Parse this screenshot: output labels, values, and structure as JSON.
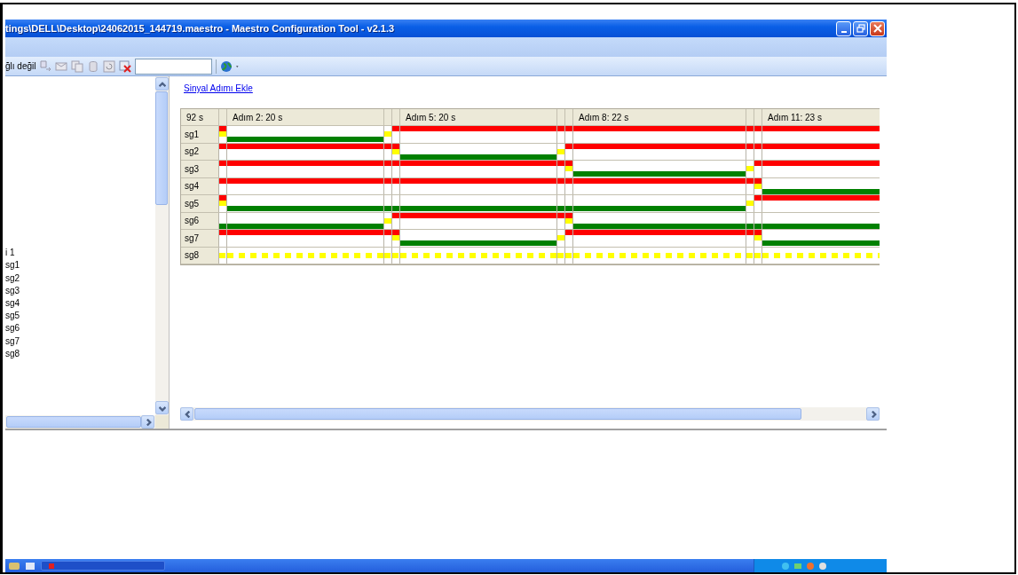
{
  "window": {
    "title": "tings\\DELL\\Desktop\\24062015_144719.maestro - Maestro Configuration Tool - v2.1.3"
  },
  "toolbar": {
    "status": "ğlı değil"
  },
  "tree": [
    {
      "label": "i 1",
      "children": [
        {
          "label": "sg1"
        },
        {
          "label": "sg2"
        },
        {
          "label": "sg3"
        },
        {
          "label": "sg4"
        },
        {
          "label": "sg5"
        },
        {
          "label": "sg6"
        },
        {
          "label": "sg7"
        },
        {
          "label": "sg8"
        }
      ]
    }
  ],
  "editor": {
    "add_link": "Sinyal Adımı Ekle",
    "total": "92 s",
    "columns": [
      {
        "kind": "transition"
      },
      {
        "kind": "step",
        "label": "Adım 2: 20 s"
      },
      {
        "kind": "transition"
      },
      {
        "kind": "transition"
      },
      {
        "kind": "step",
        "label": "Adım 5: 20 s"
      },
      {
        "kind": "transition"
      },
      {
        "kind": "transition"
      },
      {
        "kind": "step",
        "label": "Adım 8: 22 s"
      },
      {
        "kind": "transition"
      },
      {
        "kind": "transition"
      },
      {
        "kind": "step",
        "label": "Adım 11: 23 s"
      }
    ],
    "signals": [
      {
        "name": "sg1",
        "segments": [
          {
            "kind": "redamber"
          },
          {
            "kind": "green"
          },
          {
            "kind": "amber"
          },
          {
            "kind": "red"
          },
          {
            "kind": "red"
          },
          {
            "kind": "red"
          },
          {
            "kind": "red"
          },
          {
            "kind": "red"
          },
          {
            "kind": "red"
          },
          {
            "kind": "red"
          },
          {
            "kind": "red"
          }
        ]
      },
      {
        "name": "sg2",
        "segments": [
          {
            "kind": "red"
          },
          {
            "kind": "red"
          },
          {
            "kind": "red"
          },
          {
            "kind": "redamber"
          },
          {
            "kind": "green"
          },
          {
            "kind": "amber"
          },
          {
            "kind": "red"
          },
          {
            "kind": "red"
          },
          {
            "kind": "red"
          },
          {
            "kind": "red"
          },
          {
            "kind": "red"
          }
        ]
      },
      {
        "name": "sg3",
        "segments": [
          {
            "kind": "red"
          },
          {
            "kind": "red"
          },
          {
            "kind": "red"
          },
          {
            "kind": "red"
          },
          {
            "kind": "red"
          },
          {
            "kind": "red"
          },
          {
            "kind": "redamber"
          },
          {
            "kind": "green"
          },
          {
            "kind": "amber"
          },
          {
            "kind": "red"
          },
          {
            "kind": "red"
          }
        ]
      },
      {
        "name": "sg4",
        "segments": [
          {
            "kind": "red"
          },
          {
            "kind": "red"
          },
          {
            "kind": "red"
          },
          {
            "kind": "red"
          },
          {
            "kind": "red"
          },
          {
            "kind": "red"
          },
          {
            "kind": "red"
          },
          {
            "kind": "red"
          },
          {
            "kind": "red"
          },
          {
            "kind": "redamber"
          },
          {
            "kind": "green"
          }
        ]
      },
      {
        "name": "sg5",
        "segments": [
          {
            "kind": "redamber"
          },
          {
            "kind": "green"
          },
          {
            "kind": "green"
          },
          {
            "kind": "green"
          },
          {
            "kind": "green"
          },
          {
            "kind": "green"
          },
          {
            "kind": "green"
          },
          {
            "kind": "green"
          },
          {
            "kind": "amber"
          },
          {
            "kind": "red"
          },
          {
            "kind": "red"
          }
        ]
      },
      {
        "name": "sg6",
        "segments": [
          {
            "kind": "green"
          },
          {
            "kind": "green"
          },
          {
            "kind": "amber"
          },
          {
            "kind": "red"
          },
          {
            "kind": "red"
          },
          {
            "kind": "red"
          },
          {
            "kind": "redamber"
          },
          {
            "kind": "green"
          },
          {
            "kind": "green"
          },
          {
            "kind": "green"
          },
          {
            "kind": "green"
          }
        ]
      },
      {
        "name": "sg7",
        "segments": [
          {
            "kind": "red"
          },
          {
            "kind": "red"
          },
          {
            "kind": "red"
          },
          {
            "kind": "redamber"
          },
          {
            "kind": "green"
          },
          {
            "kind": "amber"
          },
          {
            "kind": "red"
          },
          {
            "kind": "red"
          },
          {
            "kind": "red"
          },
          {
            "kind": "redamber"
          },
          {
            "kind": "green"
          }
        ]
      },
      {
        "name": "sg8",
        "segments": [
          {
            "kind": "flash"
          },
          {
            "kind": "flash"
          },
          {
            "kind": "flash"
          },
          {
            "kind": "flash"
          },
          {
            "kind": "flash"
          },
          {
            "kind": "flash"
          },
          {
            "kind": "flash"
          },
          {
            "kind": "flash"
          },
          {
            "kind": "flash"
          },
          {
            "kind": "flash"
          },
          {
            "kind": "flash"
          }
        ]
      }
    ]
  }
}
